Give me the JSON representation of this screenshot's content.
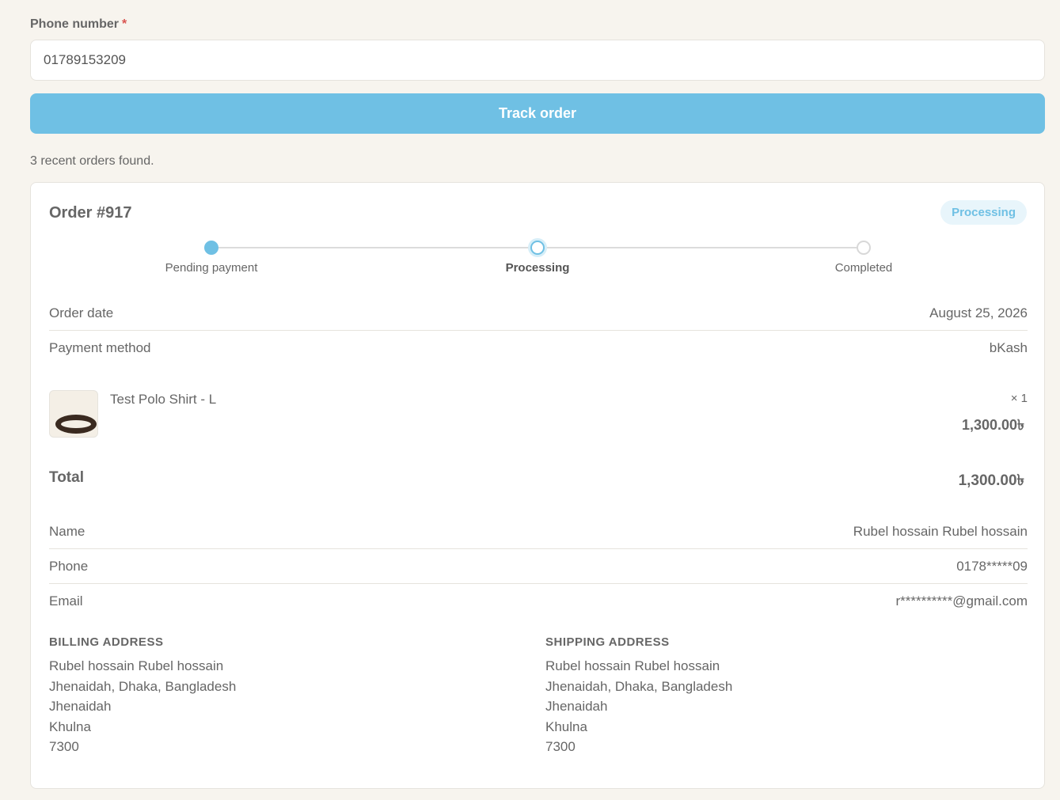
{
  "form": {
    "phone_label": "Phone number",
    "required_mark": "*",
    "phone_value": "01789153209",
    "track_button": "Track order"
  },
  "results": {
    "summary": "3 recent orders found."
  },
  "order": {
    "title": "Order #917",
    "status_badge": "Processing",
    "steps": [
      {
        "label": "Pending payment",
        "state": "done"
      },
      {
        "label": "Processing",
        "state": "current"
      },
      {
        "label": "Completed",
        "state": "upcoming"
      }
    ],
    "details": [
      {
        "label": "Order date",
        "value": "August 25, 2026"
      },
      {
        "label": "Payment method",
        "value": "bKash"
      }
    ],
    "item": {
      "image": "product-thumbnail",
      "name": "Test Polo Shirt - L",
      "qty": "× 1",
      "price": "1,300.00৳"
    },
    "total": {
      "label": "Total",
      "value": "1,300.00৳"
    },
    "customer": [
      {
        "label": "Name",
        "value": "Rubel hossain Rubel hossain"
      },
      {
        "label": "Phone",
        "value": "0178*****09"
      },
      {
        "label": "Email",
        "value": "r**********@gmail.com"
      }
    ],
    "billing": {
      "heading": "BILLING ADDRESS",
      "lines": [
        "Rubel hossain Rubel hossain",
        "Jhenaidah, Dhaka, Bangladesh",
        "Jhenaidah",
        "Khulna",
        "7300"
      ]
    },
    "shipping": {
      "heading": "SHIPPING ADDRESS",
      "lines": [
        "Rubel hossain Rubel hossain",
        "Jhenaidah, Dhaka, Bangladesh",
        "Jhenaidah",
        "Khulna",
        "7300"
      ]
    }
  },
  "colors": {
    "accent": "#6fc0e4",
    "background": "#f7f4ee"
  }
}
